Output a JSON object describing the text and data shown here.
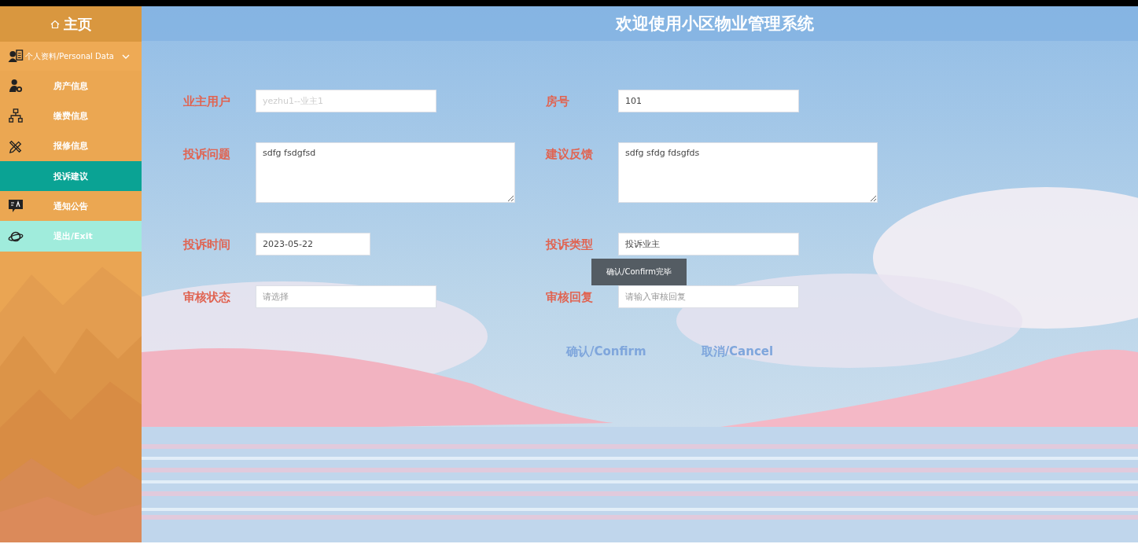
{
  "sidebar": {
    "home": "主页",
    "group": {
      "label": "个人资料/Personal Data",
      "expanded": true
    },
    "items": [
      {
        "label": "房产信息",
        "kind": "link",
        "selected": false
      },
      {
        "label": "缴费信息",
        "kind": "link",
        "selected": false
      },
      {
        "label": "报修信息",
        "kind": "link",
        "selected": false
      },
      {
        "label": "投诉建议",
        "kind": "link",
        "selected": true
      },
      {
        "label": "通知公告",
        "kind": "link",
        "selected": false
      },
      {
        "label": "退出/Exit",
        "kind": "exit",
        "selected": false
      }
    ]
  },
  "header": {
    "title": "欢迎使用小区物业管理系统"
  },
  "form": {
    "rows": [
      [
        {
          "label": "业主用户",
          "kind": "input",
          "placeholder": "yezhu1--业主1"
        },
        {
          "label": "房号",
          "kind": "input",
          "value": "101"
        }
      ],
      [
        {
          "label": "投诉问题",
          "kind": "textarea",
          "value": "sdfg fsdgfsd"
        },
        {
          "label": "建议反馈",
          "kind": "textarea",
          "value": "sdfg sfdg fdsgfds"
        }
      ],
      [
        {
          "label": "投诉时间",
          "kind": "input",
          "value": "2023-05-22"
        },
        {
          "label": "投诉类型",
          "kind": "input",
          "value": "投诉业主"
        }
      ],
      [
        {
          "label": "审核状态",
          "kind": "input",
          "placeholder": "请选择"
        },
        {
          "label": "审核回复",
          "kind": "input",
          "placeholder": "请输入审核回复"
        }
      ]
    ],
    "buttons": [
      "确认/Confirm",
      "取消/Cancel"
    ]
  },
  "toast": "确认/Confirm完毕"
}
